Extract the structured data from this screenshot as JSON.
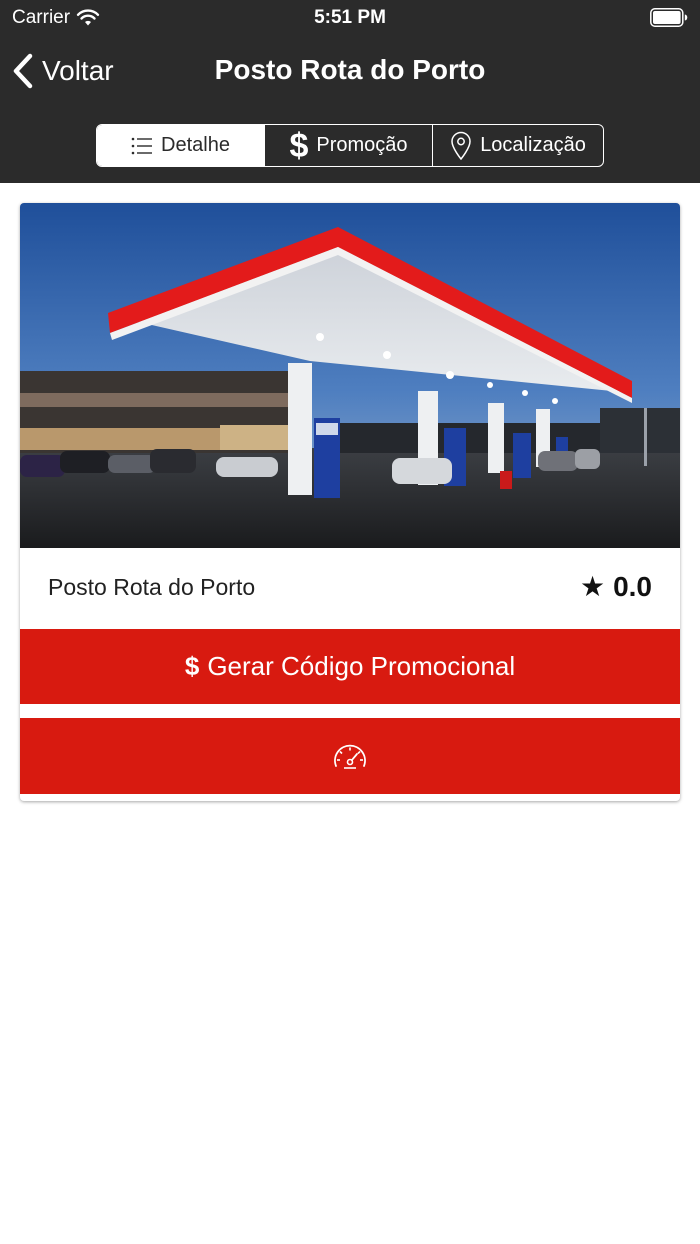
{
  "status_bar": {
    "carrier": "Carrier",
    "time": "5:51 PM"
  },
  "nav": {
    "back_label": "Voltar",
    "title": "Posto Rota do Porto"
  },
  "tabs": [
    {
      "label": "Detalhe",
      "icon": "list-icon",
      "active": true
    },
    {
      "label": "Promoção",
      "icon": "dollar-icon",
      "active": false
    },
    {
      "label": "Localização",
      "icon": "location-pin-icon",
      "active": false
    }
  ],
  "tab_dollar_symbol": "$",
  "station": {
    "name": "Posto Rota do Porto",
    "rating": "0.0",
    "star_symbol": "★",
    "photo": "gas-station-photo"
  },
  "promo_button": {
    "symbol": "$",
    "label": "Gerar Código Promocional"
  },
  "speed_button": {
    "icon": "speedometer-icon"
  },
  "colors": {
    "header_bg": "#2b2b2b",
    "accent_red": "#d81a10",
    "white": "#ffffff"
  }
}
